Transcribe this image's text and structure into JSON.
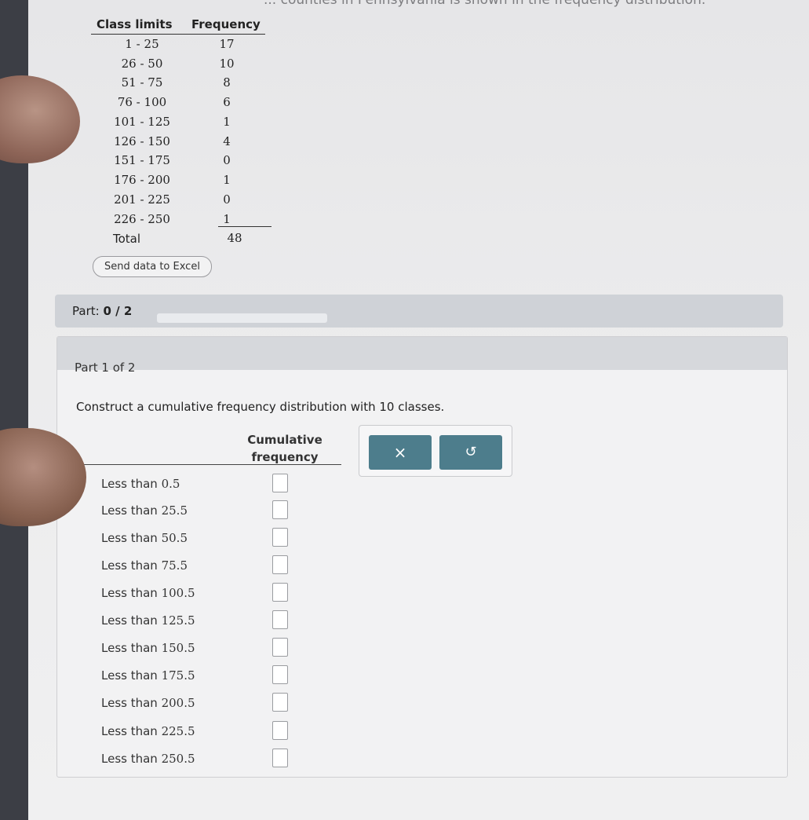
{
  "top_text": "... counties in Pennsylvania is shown in the frequency distribution.",
  "frequency_table": {
    "header_class_limits": "Class limits",
    "header_frequency": "Frequency",
    "rows": [
      {
        "limits": "1 - 25",
        "freq": "17"
      },
      {
        "limits": "26 - 50",
        "freq": "10"
      },
      {
        "limits": "51 - 75",
        "freq": "8"
      },
      {
        "limits": "76 - 100",
        "freq": "6"
      },
      {
        "limits": "101 - 125",
        "freq": "1"
      },
      {
        "limits": "126 - 150",
        "freq": "4"
      },
      {
        "limits": "151 - 175",
        "freq": "0"
      },
      {
        "limits": "176 - 200",
        "freq": "1"
      },
      {
        "limits": "201 - 225",
        "freq": "0"
      },
      {
        "limits": "226 - 250",
        "freq": "1"
      }
    ],
    "total_label": "Total",
    "total_value": "48"
  },
  "send_excel_label": "Send data to Excel",
  "part_bar": {
    "label_prefix": "Part:",
    "progress": "0 / 2",
    "progress_fraction": 0
  },
  "part1": {
    "title": "Part 1 of 2",
    "instruction": "Construct a cumulative frequency distribution with 10 classes.",
    "cumulative_header_line1": "Cumulative",
    "cumulative_header_line2": "frequency",
    "rows": [
      {
        "prefix": "Less than",
        "value": "0.5"
      },
      {
        "prefix": "Less than",
        "value": "25.5"
      },
      {
        "prefix": "Less than",
        "value": "50.5"
      },
      {
        "prefix": "Less than",
        "value": "75.5"
      },
      {
        "prefix": "Less than",
        "value": "100.5"
      },
      {
        "prefix": "Less than",
        "value": "125.5"
      },
      {
        "prefix": "Less than",
        "value": "150.5"
      },
      {
        "prefix": "Less than",
        "value": "175.5"
      },
      {
        "prefix": "Less than",
        "value": "200.5"
      },
      {
        "prefix": "Less than",
        "value": "225.5"
      },
      {
        "prefix": "Less than",
        "value": "250.5"
      }
    ]
  },
  "tools": {
    "clear_icon": "×",
    "undo_icon": "↺"
  },
  "colors": {
    "tool_button": "#4d7d8c",
    "part_bar": "#cfd2d7"
  }
}
